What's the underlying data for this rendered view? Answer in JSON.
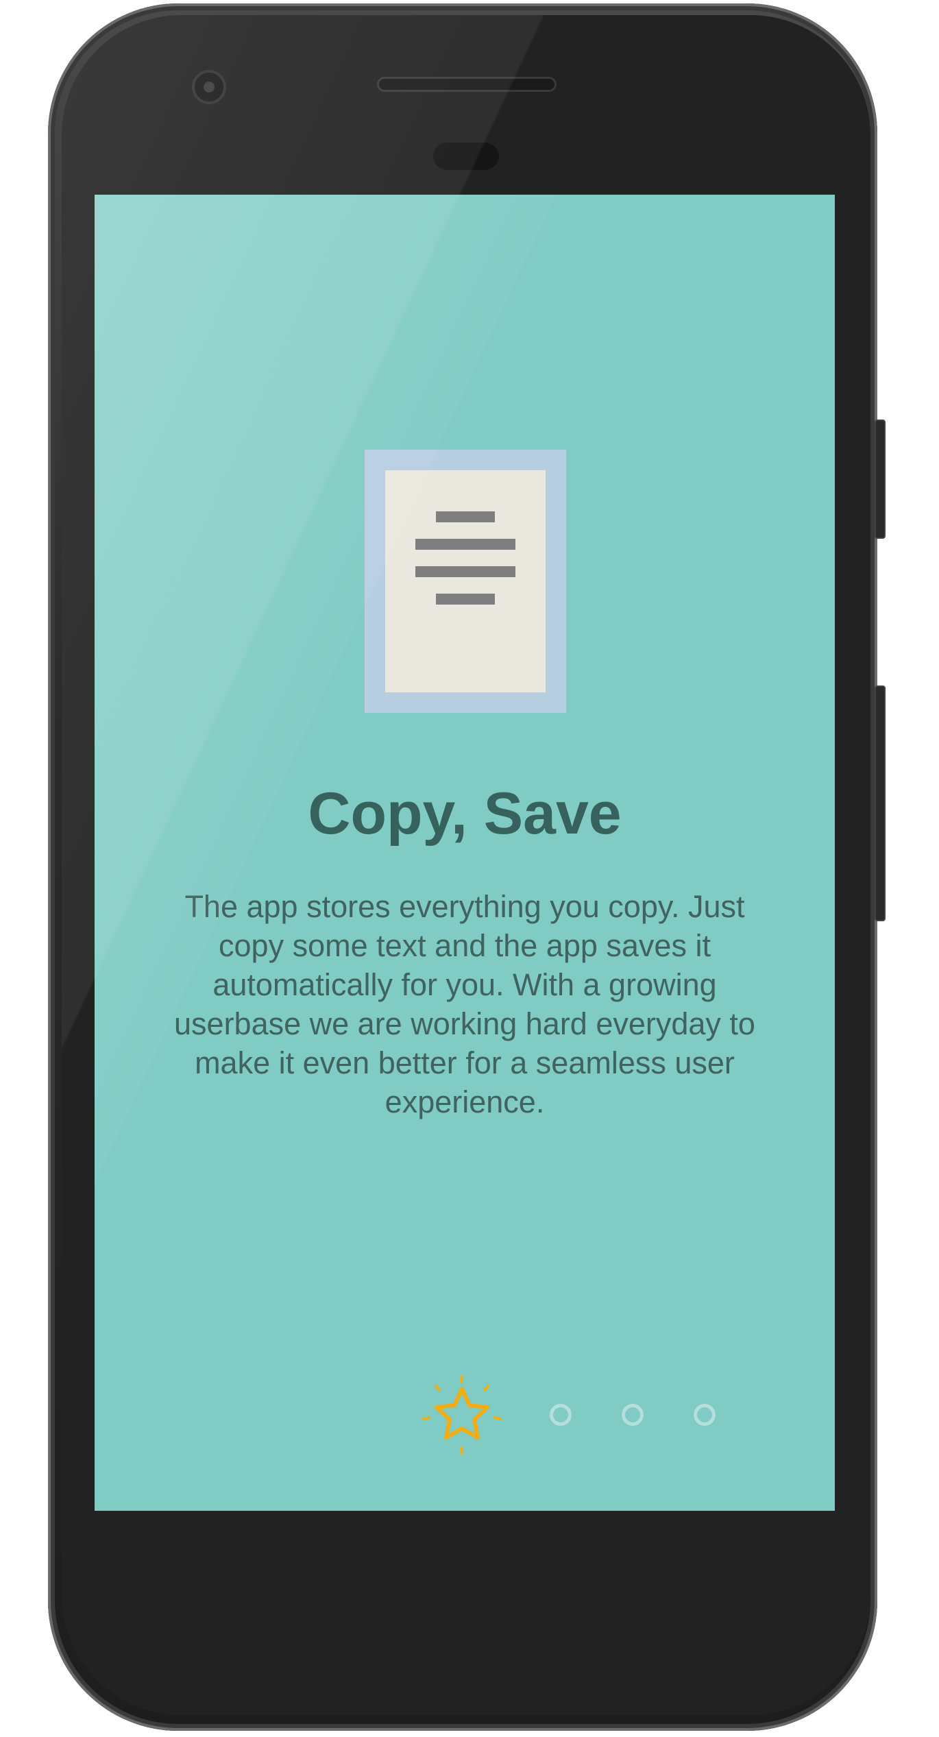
{
  "onboarding": {
    "title": "Copy, Save",
    "description": "The app stores everything you copy. Just copy some text and the app saves it automatically for you. With a growing userbase we are working hard everyday to make it even better for a seamless user experience.",
    "illustration_icon": "document-icon",
    "page_indicator": {
      "total_pages": 4,
      "current_page": 1,
      "active_icon": "star-icon",
      "active_color": "#f0ad18",
      "inactive_color": "#b5dfda"
    }
  },
  "colors": {
    "screen_background": "#80cbc4",
    "title_color": "#37615d",
    "body_color": "#40635f",
    "document_frame": "#b8cfe2",
    "document_paper": "#ebe8e0",
    "document_lines": "#7f7f7f"
  }
}
